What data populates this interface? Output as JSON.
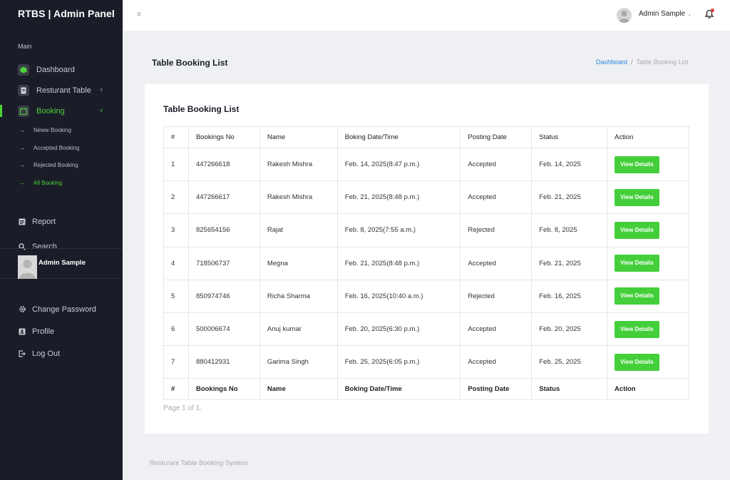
{
  "brand": "RTBS | Admin Panel",
  "sidebar": {
    "section_label": "Main",
    "items": [
      {
        "label": "Dashboard"
      },
      {
        "label": "Resturant Table"
      },
      {
        "label": "Booking"
      }
    ],
    "sub_items": [
      {
        "label": "Neww Booking"
      },
      {
        "label": "Accepted Booking"
      },
      {
        "label": "Rejected Booking"
      },
      {
        "label": "All Booking"
      }
    ],
    "report": "Report",
    "search": "Search",
    "user_name": "Admin Sample",
    "bottom": [
      {
        "label": "Change Password"
      },
      {
        "label": "Profile"
      },
      {
        "label": "Log Out"
      }
    ]
  },
  "topbar": {
    "user_name": "Admin Sample"
  },
  "page": {
    "title": "Table Booking List",
    "breadcrumb_home": "Dashboard",
    "breadcrumb_current": "Table Booking List"
  },
  "card": {
    "title": "Table Booking List",
    "columns": [
      "#",
      "Bookings No",
      "Name",
      "Boking Date/Time",
      "Posting Date",
      "Status",
      "Action"
    ],
    "footer_columns": [
      "#",
      "Bookings No",
      "Name",
      "Boking Date/Time",
      "Posting Date",
      "Status",
      "Action"
    ],
    "rows": [
      {
        "n": "1",
        "no": "447266618",
        "name": "Rakesh Mishra",
        "dt": "Feb. 14, 2025(8:47 p.m.)",
        "posting": "Accepted",
        "status": "Feb. 14, 2025",
        "action": "View Details"
      },
      {
        "n": "2",
        "no": "447266617",
        "name": "Rakesh Mishra",
        "dt": "Feb. 21, 2025(8:48 p.m.)",
        "posting": "Accepted",
        "status": "Feb. 21, 2025",
        "action": "View Details"
      },
      {
        "n": "3",
        "no": "825654156",
        "name": "Rajat",
        "dt": "Feb. 8, 2025(7:55 a.m.)",
        "posting": "Rejected",
        "status": "Feb. 8, 2025",
        "action": "View Details"
      },
      {
        "n": "4",
        "no": "718506737",
        "name": "Megna",
        "dt": "Feb. 21, 2025(8:48 p.m.)",
        "posting": "Accepted",
        "status": "Feb. 21, 2025",
        "action": "View Details"
      },
      {
        "n": "5",
        "no": "850974746",
        "name": "Richa Sharma",
        "dt": "Feb. 16, 2025(10:40 a.m.)",
        "posting": "Rejected",
        "status": "Feb. 16, 2025",
        "action": "View Details"
      },
      {
        "n": "6",
        "no": "500006674",
        "name": "Anuj kumar",
        "dt": "Feb. 20, 2025(6:30 p.m.)",
        "posting": "Accepted",
        "status": "Feb. 20, 2025",
        "action": "View Details"
      },
      {
        "n": "7",
        "no": "880412931",
        "name": "Garima Singh",
        "dt": "Feb. 25, 2025(6:05 p.m.)",
        "posting": "Accepted",
        "status": "Feb. 25, 2025",
        "action": "View Details"
      }
    ],
    "pager": "Page 1 of 1."
  },
  "footer": "Resturant Table Booking System",
  "colors": {
    "accent": "#44cf3a",
    "sidebar": "#1a1d28",
    "link": "#2e86de"
  },
  "icons": [
    "menu-icon",
    "dashboard-icon",
    "table-icon",
    "booking-icon",
    "chevron-left-icon",
    "arrow-right-icon",
    "report-icon",
    "search-icon",
    "gear-icon",
    "profile-icon",
    "logout-icon",
    "bell-icon",
    "caret-down-icon"
  ]
}
